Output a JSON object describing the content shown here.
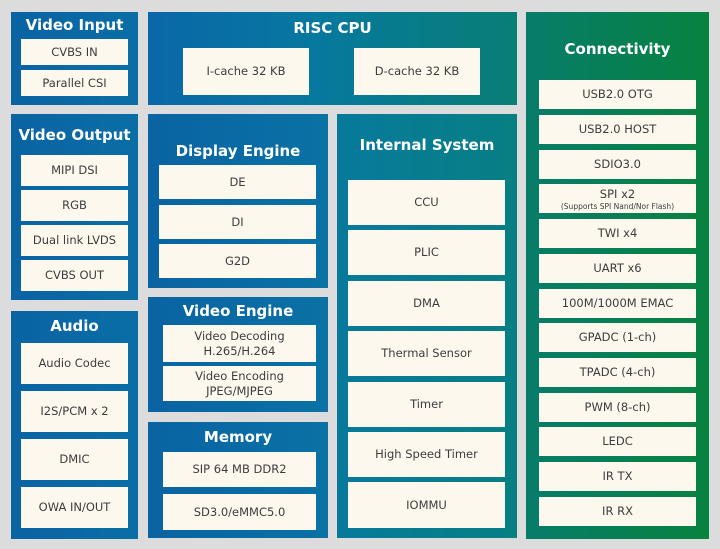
{
  "colors": {
    "background": "#dcdcdc",
    "blue_block": "#0a6aa6",
    "green_block": "#07823f",
    "item_fill": "#fdf8ee",
    "item_text": "#3c3c3c",
    "title_text": "#ffffff"
  },
  "blocks": {
    "video_input": {
      "title": "Video Input",
      "items": [
        "CVBS IN",
        "Parallel CSI"
      ]
    },
    "video_output": {
      "title": "Video Output",
      "items": [
        "MIPI DSI",
        "RGB",
        "Dual link LVDS",
        "CVBS OUT"
      ]
    },
    "audio": {
      "title": "Audio",
      "items": [
        "Audio Codec",
        "I2S/PCM x 2",
        "DMIC",
        "OWA IN/OUT"
      ]
    },
    "risc_cpu": {
      "title": "RISC CPU",
      "items": [
        "I-cache 32 KB",
        "D-cache 32 KB"
      ]
    },
    "display_engine": {
      "title": "Display Engine",
      "items": [
        "DE",
        "DI",
        "G2D"
      ]
    },
    "video_engine": {
      "title": "Video Engine",
      "items": [
        {
          "line1": "Video Decoding",
          "line2": "H.265/H.264"
        },
        {
          "line1": "Video Encoding",
          "line2": "JPEG/MJPEG"
        }
      ]
    },
    "memory": {
      "title": "Memory",
      "items": [
        "SIP 64 MB DDR2",
        "SD3.0/eMMC5.0"
      ]
    },
    "internal_system": {
      "title": "Internal System",
      "items": [
        "CCU",
        "PLIC",
        "DMA",
        "Thermal Sensor",
        "Timer",
        "High Speed Timer",
        "IOMMU"
      ]
    },
    "connectivity": {
      "title": "Connectivity",
      "items": [
        "USB2.0 OTG",
        "USB2.0 HOST",
        "SDIO3.0",
        "SPI x2",
        "TWI x4",
        "UART x6",
        "100M/1000M EMAC",
        "GPADC (1-ch)",
        "TPADC (4-ch)",
        "PWM (8-ch)",
        "LEDC",
        "IR TX",
        "IR RX"
      ],
      "spi_note": "(Supports SPI Nand/Nor Flash)"
    }
  }
}
